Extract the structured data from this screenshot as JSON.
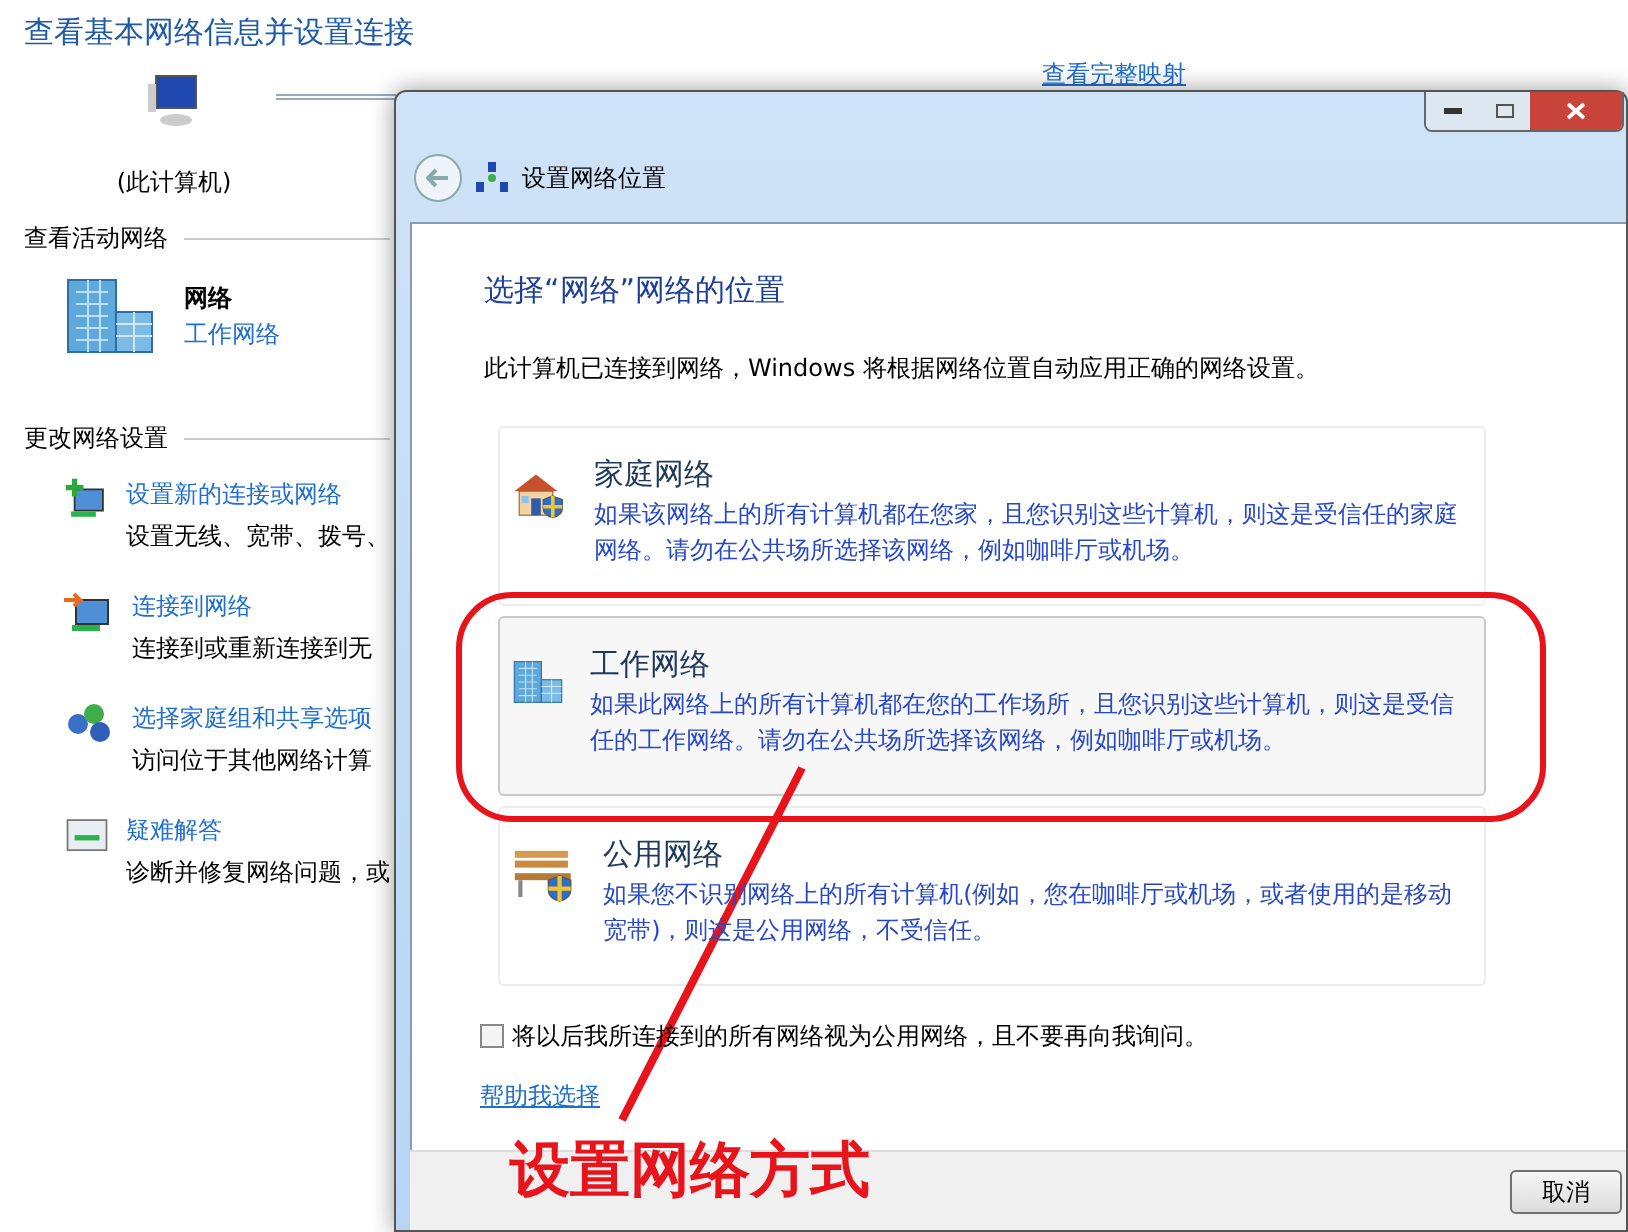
{
  "page": {
    "title": "查看基本网络信息并设置连接",
    "map_link": "查看完整映射",
    "computer_label": "(此计算机)"
  },
  "active_section": {
    "heading": "查看活动网络",
    "network_name": "网络",
    "network_type": "工作网络"
  },
  "change_section": {
    "heading": "更改网络设置",
    "tasks": [
      {
        "kind": "new",
        "link": "设置新的连接或网络",
        "description": "设置无线、宽带、拨号、"
      },
      {
        "kind": "connect",
        "link": "连接到网络",
        "description": "连接到或重新连接到无"
      },
      {
        "kind": "homegroup",
        "link": "选择家庭组和共享选项",
        "description": "访问位于其他网络计算"
      },
      {
        "kind": "troubleshoot",
        "link": "疑难解答",
        "description": "诊断并修复网络问题，或"
      }
    ]
  },
  "dialog": {
    "title": "设置网络位置",
    "heading": "选择“网络”网络的位置",
    "intro": "此计算机已连接到网络，Windows 将根据网络位置自动应用正确的网络设置。",
    "locations": [
      {
        "kind": "home",
        "title": "家庭网络",
        "description": "如果该网络上的所有计算机都在您家，且您识别这些计算机，则这是受信任的家庭网络。请勿在公共场所选择该网络，例如咖啡厅或机场。",
        "selected": false
      },
      {
        "kind": "work",
        "title": "工作网络",
        "description": "如果此网络上的所有计算机都在您的工作场所，且您识别这些计算机，则这是受信任的工作网络。请勿在公共场所选择该网络，例如咖啡厅或机场。",
        "selected": true
      },
      {
        "kind": "public",
        "title": "公用网络",
        "description": "如果您不识别网络上的所有计算机(例如，您在咖啡厅或机场，或者使用的是移动宽带)，则这是公用网络，不受信任。",
        "selected": false
      }
    ],
    "checkbox": {
      "label": "将以后我所连接到的所有网络视为公用网络，且不要再向我询问。",
      "checked": false
    },
    "help_link": "帮助我选择",
    "cancel_button": "取消"
  },
  "annotation": {
    "text": "设置网络方式"
  }
}
